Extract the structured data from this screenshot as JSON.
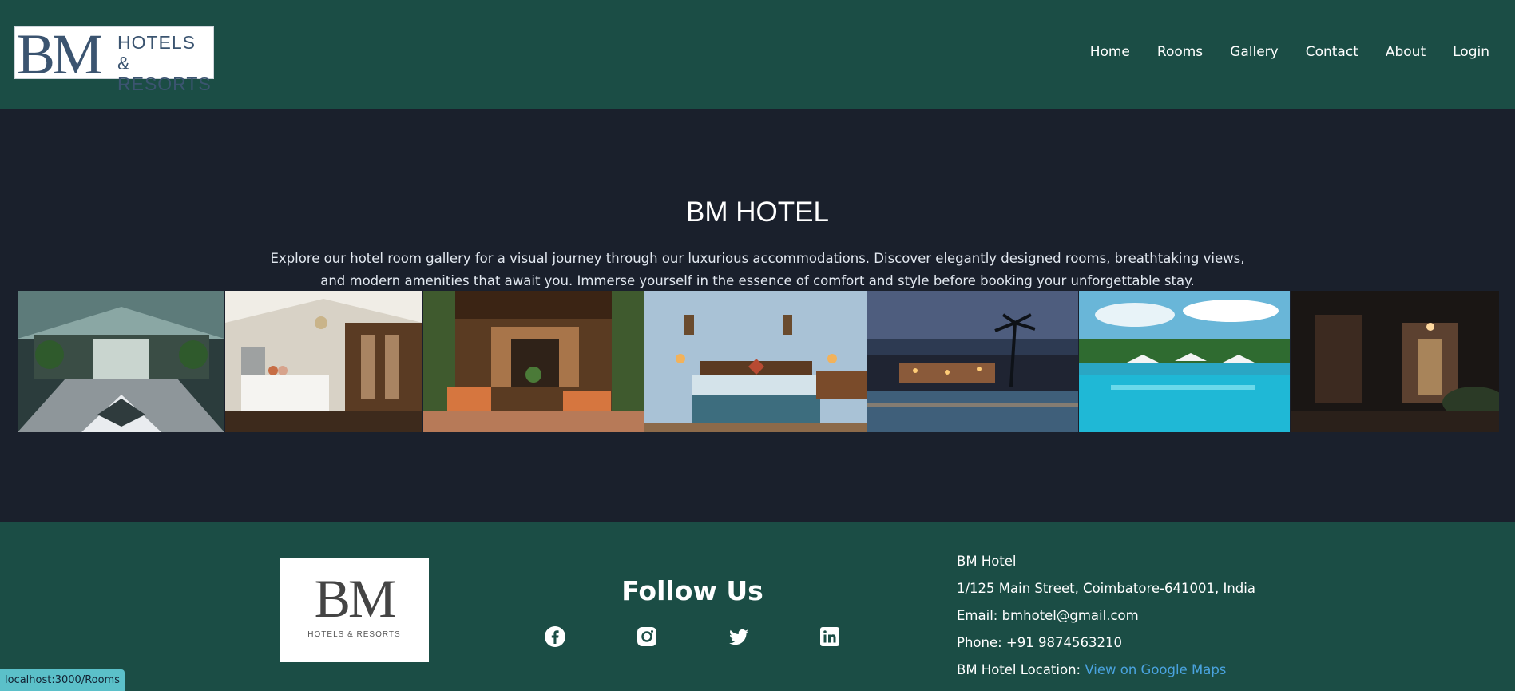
{
  "header": {
    "logo": {
      "mark": "BM",
      "line1": "HOTELS &",
      "line2": "RESORTS"
    },
    "nav": [
      "Home",
      "Rooms",
      "Gallery",
      "Contact",
      "About",
      "Login"
    ]
  },
  "hero": {
    "title": "BM HOTEL",
    "description": "Explore our hotel room gallery for a visual journey through our luxurious accommodations. Discover elegantly designed rooms, breathtaking views, and modern amenities that await you. Immerse yourself in the essence of comfort and style before booking your unforgettable stay."
  },
  "gallery": {
    "images": [
      "lobby-atrium",
      "white-bedroom",
      "ornate-lounge",
      "blue-bedroom",
      "pool-at-dusk",
      "outdoor-pool",
      "night-entrance"
    ]
  },
  "footer": {
    "logo": {
      "mark": "BM",
      "sub": "HOTELS & RESORTS"
    },
    "follow_title": "Follow Us",
    "social": [
      "facebook-icon",
      "instagram-icon",
      "twitter-icon",
      "linkedin-icon"
    ],
    "contact": {
      "name": "BM Hotel",
      "address": "1/125 Main Street, Coimbatore-641001, India",
      "email": "Email: bmhotel@gmail.com",
      "phone": "Phone: +91 9874563210",
      "location_label": "BM Hotel Location: ",
      "location_link": "View on Google Maps"
    }
  },
  "status_bar": "localhost:3000/Rooms",
  "colors": {
    "header_bg": "#1b4d45",
    "body_bg": "#1a202c",
    "link": "#4aa3df"
  }
}
